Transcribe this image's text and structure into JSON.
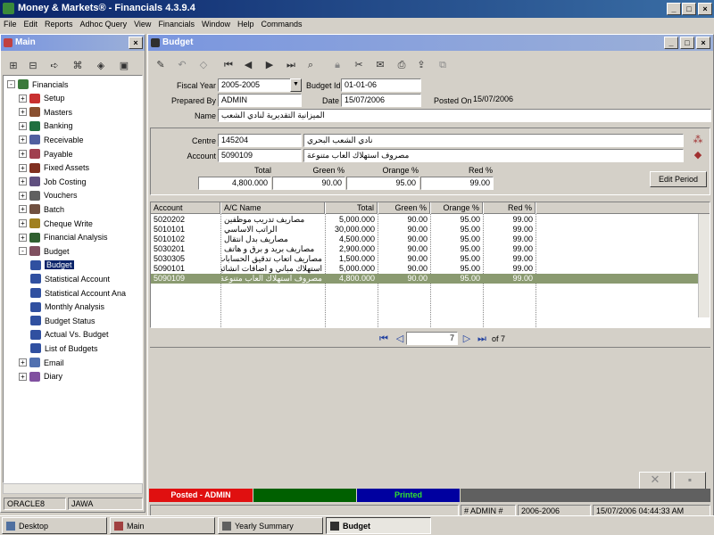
{
  "app": {
    "title": "Money & Markets® - Financials 4.3.9.4"
  },
  "menu": [
    "File",
    "Edit",
    "Reports",
    "Adhoc Query",
    "View",
    "Financials",
    "Window",
    "Help",
    "Commands"
  ],
  "main_panel": {
    "title": "Main",
    "tree": [
      {
        "label": "Financials",
        "level": 0,
        "color": "#3a7a3a",
        "exp": "-"
      },
      {
        "label": "Setup",
        "level": 1,
        "color": "#c83030",
        "exp": "+"
      },
      {
        "label": "Masters",
        "level": 1,
        "color": "#8a5030",
        "exp": "+"
      },
      {
        "label": "Banking",
        "level": 1,
        "color": "#207040",
        "exp": "+"
      },
      {
        "label": "Receivable",
        "level": 1,
        "color": "#5060a0",
        "exp": "+"
      },
      {
        "label": "Payable",
        "level": 1,
        "color": "#a04050",
        "exp": "+"
      },
      {
        "label": "Fixed Assets",
        "level": 1,
        "color": "#803020",
        "exp": "+"
      },
      {
        "label": "Job Costing",
        "level": 1,
        "color": "#605080",
        "exp": "+"
      },
      {
        "label": "Vouchers",
        "level": 1,
        "color": "#606060",
        "exp": "+"
      },
      {
        "label": "Batch",
        "level": 1,
        "color": "#705040",
        "exp": "+"
      },
      {
        "label": "Cheque Write",
        "level": 1,
        "color": "#a08020",
        "exp": "+"
      },
      {
        "label": "Financial Analysis",
        "level": 1,
        "color": "#306030",
        "exp": "+"
      },
      {
        "label": "Budget",
        "level": 1,
        "color": "#805060",
        "exp": "-"
      },
      {
        "label": "Budget",
        "level": 2,
        "color": "#3050a0",
        "exp": "",
        "selected": true
      },
      {
        "label": "Statistical Account",
        "level": 2,
        "color": "#3050a0",
        "exp": ""
      },
      {
        "label": "Statistical Account Ana",
        "level": 2,
        "color": "#3050a0",
        "exp": ""
      },
      {
        "label": "Monthly Analysis",
        "level": 2,
        "color": "#3050a0",
        "exp": ""
      },
      {
        "label": "Budget Status",
        "level": 2,
        "color": "#3050a0",
        "exp": ""
      },
      {
        "label": "Actual Vs. Budget",
        "level": 2,
        "color": "#3050a0",
        "exp": ""
      },
      {
        "label": "List of Budgets",
        "level": 2,
        "color": "#3050a0",
        "exp": ""
      },
      {
        "label": "Email",
        "level": 1,
        "color": "#5070b0",
        "exp": "+"
      },
      {
        "label": "Diary",
        "level": 1,
        "color": "#8050a0",
        "exp": "+"
      }
    ],
    "status": {
      "db": "ORACLE8",
      "user": "JAWA"
    }
  },
  "budget": {
    "title": "Budget",
    "fiscal_year_label": "Fiscal Year",
    "fiscal_year": "2005-2005",
    "budget_id_label": "Budget Id",
    "budget_id": "01-01-06",
    "prepared_by_label": "Prepared By",
    "prepared_by": "ADMIN",
    "date_label": "Date",
    "date": "15/07/2006",
    "posted_on_label": "Posted On",
    "posted_on": "15/07/2006",
    "name_label": "Name",
    "name": "الميزانية التقديرية لنادي الشعب",
    "centre_label": "Centre",
    "centre_code": "145204",
    "centre_name": "نادي الشعب البحري",
    "account_label": "Account",
    "account_code": "5090109",
    "account_name": "مصروف استهلاك العاب متنوعة",
    "totals_headers": {
      "total": "Total",
      "green": "Green %",
      "orange": "Orange %",
      "red": "Red %"
    },
    "totals": {
      "total": "4,800.000",
      "green": "90.00",
      "orange": "95.00",
      "red": "99.00"
    },
    "edit_period": "Edit Period",
    "columns": [
      "Account",
      "A/C Name",
      "Total",
      "Green %",
      "Orange %",
      "Red %"
    ],
    "rows": [
      [
        "5020202",
        "مصاريف تدريب موظفين",
        "5,000.000",
        "90.00",
        "95.00",
        "99.00"
      ],
      [
        "5010101",
        "الراتب الاساسي",
        "30,000.000",
        "90.00",
        "95.00",
        "99.00"
      ],
      [
        "5010102",
        "مصاريف بدل انتقال",
        "4,500.000",
        "90.00",
        "95.00",
        "99.00"
      ],
      [
        "5030201",
        "مصاريف بريد و برق و هاتف",
        "2,900.000",
        "90.00",
        "95.00",
        "99.00"
      ],
      [
        "5030305",
        "مصاريف اتعاب تدقيق الحسابات",
        "1,500.000",
        "90.00",
        "95.00",
        "99.00"
      ],
      [
        "5090101",
        "استهلاك مباني و اضافات انشائية",
        "5,000.000",
        "90.00",
        "95.00",
        "99.00"
      ],
      [
        "5090109",
        "مصروف استهلاك العاب متنوعة",
        "4,800.000",
        "90.00",
        "95.00",
        "99.00"
      ]
    ],
    "selected_row": 6,
    "pager": {
      "current": "7",
      "of": "of 7"
    },
    "status_cells": {
      "posted": "Posted - ADMIN",
      "printed": "Printed"
    },
    "status_colors": {
      "posted": "#e01010",
      "green": "#006000",
      "printed": "#0000a0",
      "rest": "#606060"
    },
    "bottom": {
      "user": "# ADMIN #",
      "period": "2006-2006",
      "datetime": "15/07/2006  04:44:33 AM"
    }
  },
  "taskbar": [
    "Desktop",
    "Main",
    "Yearly Summary",
    "Budget"
  ]
}
